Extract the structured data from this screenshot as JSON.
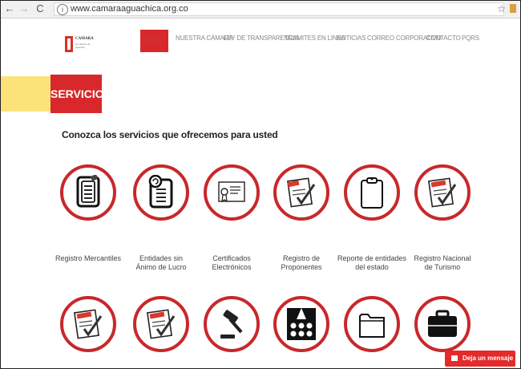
{
  "browser": {
    "url": "www.camaraaguachica.org.co",
    "info_glyph": "i",
    "back_glyph": "←",
    "forward_glyph": "→",
    "reload_glyph": "C",
    "star_glyph": "☆"
  },
  "header": {
    "logo": {
      "title": "CAMARA",
      "subtitle": "de comercio de aguachica"
    },
    "menu": [
      {
        "label": "INICIO",
        "active": true
      },
      {
        "label": "NUESTRA CÁMARA"
      },
      {
        "label": "LEY DE TRANSPARENCIA"
      },
      {
        "label": "TRAMITES EN LINEA"
      },
      {
        "label": "NOTICIAS"
      },
      {
        "label": "CORREO CORPORATIVO"
      },
      {
        "label": "CONTACTO"
      },
      {
        "label": "PQRS"
      }
    ]
  },
  "banner": {
    "title": "SERVICIOS"
  },
  "intro": "Conozca los servicios que ofrecemos para usted",
  "services": [
    {
      "line1": "Registro Mercantiles",
      "line2": "",
      "icon": "document-icon"
    },
    {
      "line1": "Entidades sin",
      "line2": "Ánimo de Lucro",
      "icon": "document-refresh-icon"
    },
    {
      "line1": "Certificados",
      "line2": "Electrónicos",
      "icon": "certificate-icon"
    },
    {
      "line1": "Registro de",
      "line2": "Proponentes",
      "icon": "checklist-icon"
    },
    {
      "line1": "Reporte de entidades",
      "line2": "del estado",
      "icon": "clipboard-icon"
    },
    {
      "line1": "Registro Nacional",
      "line2": "de Turismo",
      "icon": "checklist-turismo-icon"
    },
    {
      "line1": "",
      "line2": "",
      "icon": "checklist-emergencia-icon"
    },
    {
      "line1": "",
      "line2": "",
      "icon": "checklist-red-icon"
    },
    {
      "line1": "",
      "line2": "",
      "icon": "gavel-icon"
    },
    {
      "line1": "",
      "line2": "",
      "icon": "audience-icon"
    },
    {
      "line1": "",
      "line2": "",
      "icon": "folder-icon"
    },
    {
      "line1": "",
      "line2": "",
      "icon": "briefcase-icon"
    }
  ],
  "chat": {
    "label": "Deja un mensaje"
  }
}
